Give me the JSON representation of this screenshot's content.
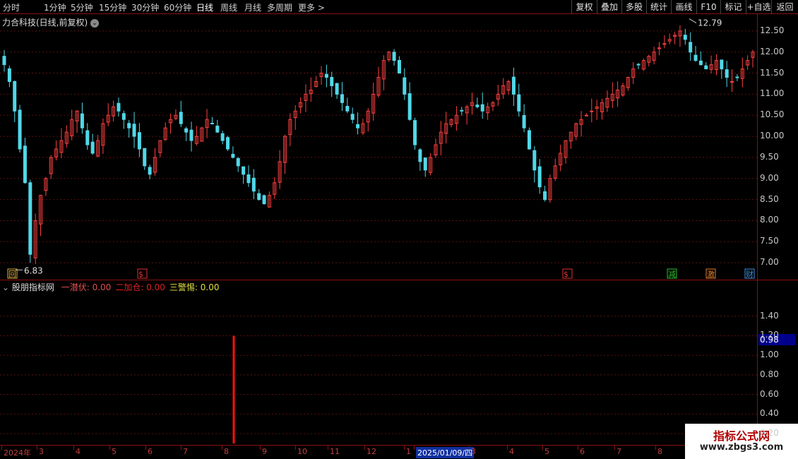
{
  "toolbar": {
    "left": [
      "分时",
      "1分钟",
      "5分钟",
      "15分钟",
      "30分钟",
      "60分钟",
      "日线",
      "周线",
      "月线",
      "多周期",
      "更多 >"
    ],
    "active": "日线",
    "right": [
      "复权",
      "叠加",
      "多股",
      "统计",
      "画线",
      "F10",
      "标记",
      "+自选",
      "返回"
    ]
  },
  "main": {
    "title": "力合科技(日线,前复权)",
    "high_label": "12.79",
    "low_label": "6.83",
    "y_ticks": [
      "12.50",
      "12.00",
      "11.50",
      "11.00",
      "10.50",
      "10.00",
      "9.50",
      "9.00",
      "8.50",
      "8.00",
      "7.50",
      "7.00"
    ],
    "markers": [
      {
        "text": "回",
        "color": "#e0b040"
      },
      {
        "text": "$",
        "color": "#e03030"
      },
      {
        "text": "$",
        "color": "#e03030"
      },
      {
        "text": "减",
        "color": "#30c030"
      },
      {
        "text": "激",
        "color": "#e08030"
      },
      {
        "text": "财",
        "color": "#4090e0"
      }
    ]
  },
  "indicator": {
    "name": "股朋指标网",
    "items": [
      {
        "label": "一潜伏:",
        "value": "0.00",
        "color": "#e05050"
      },
      {
        "label": "二加仓:",
        "value": "0.00",
        "color": "#e02020"
      },
      {
        "label": "三警惕:",
        "value": "0.00",
        "color": "#e0e040"
      }
    ],
    "y_ticks": [
      "1.40",
      "1.20",
      "1.00",
      "0.80",
      "0.60",
      "0.40",
      "0.20"
    ],
    "current_value": "0.98"
  },
  "dates": [
    "2024年",
    "3",
    "4",
    "5",
    "6",
    "7",
    "8",
    "9",
    "10",
    "11",
    "12",
    "1",
    "2025/01/09/四",
    "3",
    "4",
    "5",
    "6",
    "7",
    "8"
  ],
  "watermark": {
    "line1": "指标公式网",
    "line2": "www.zbgs3.com"
  },
  "chart_data": {
    "type": "candlestick",
    "y_range_main": [
      6.6,
      12.9
    ],
    "y_range_indicator": [
      0.1,
      1.6
    ],
    "price_high": 12.79,
    "price_low": 6.83,
    "indicator_signal_value": 1.2,
    "indicator_current": 0.98,
    "close_approx": [
      11.7,
      11.3,
      10.6,
      9.7,
      8.9,
      7.2,
      8.0,
      8.6,
      9.0,
      9.5,
      9.7,
      9.9,
      10.1,
      10.4,
      10.6,
      10.2,
      9.8,
      9.6,
      9.9,
      10.3,
      10.5,
      10.7,
      10.6,
      10.4,
      10.2,
      10.0,
      9.7,
      9.3,
      9.1,
      9.5,
      9.9,
      10.2,
      10.4,
      10.5,
      10.3,
      10.1,
      9.9,
      10.0,
      10.2,
      10.4,
      10.3,
      10.1,
      9.9,
      9.7,
      9.5,
      9.3,
      9.1,
      8.9,
      8.7,
      8.5,
      8.4,
      8.6,
      8.9,
      9.4,
      10.0,
      10.4,
      10.6,
      10.8,
      11.0,
      11.1,
      11.3,
      11.5,
      11.4,
      11.2,
      11.0,
      10.8,
      10.6,
      10.4,
      10.2,
      10.3,
      10.6,
      11.0,
      11.4,
      11.8,
      12.0,
      11.8,
      11.5,
      11.0,
      10.4,
      9.8,
      9.4,
      9.2,
      9.5,
      9.8,
      10.1,
      10.3,
      10.4,
      10.5,
      10.6,
      10.7,
      10.8,
      10.7,
      10.6,
      10.7,
      10.8,
      11.0,
      11.2,
      11.3,
      11.0,
      10.6,
      10.2,
      9.7,
      9.2,
      8.8,
      8.5,
      9.0,
      9.3,
      9.6,
      9.9,
      10.1,
      10.3,
      10.4,
      10.5,
      10.6,
      10.7,
      10.8,
      10.9,
      11.0,
      11.1,
      11.2,
      11.4,
      11.6,
      11.7,
      11.8,
      11.9,
      12.0,
      12.1,
      12.2,
      12.3,
      12.4,
      12.5,
      12.3,
      12.0,
      11.8,
      11.7,
      11.6,
      11.7,
      11.8,
      11.6,
      11.4,
      11.3,
      11.4,
      11.6,
      11.8,
      12.0
    ]
  }
}
